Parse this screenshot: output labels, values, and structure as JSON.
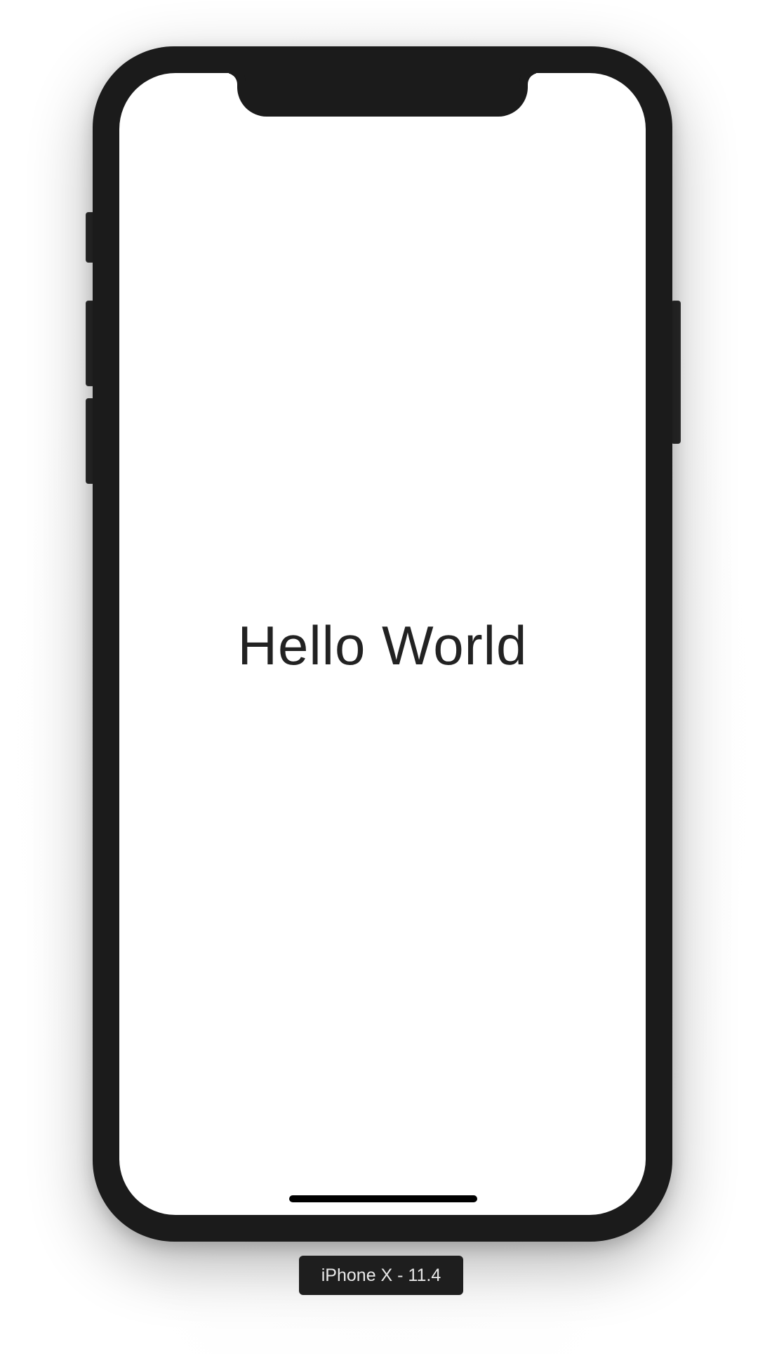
{
  "screen": {
    "main_text": "Hello World"
  },
  "simulator": {
    "device_label": "iPhone X - 11.4"
  },
  "colors": {
    "device_frame": "#1b1b1b",
    "screen_background": "#ffffff",
    "text": "#222222"
  }
}
